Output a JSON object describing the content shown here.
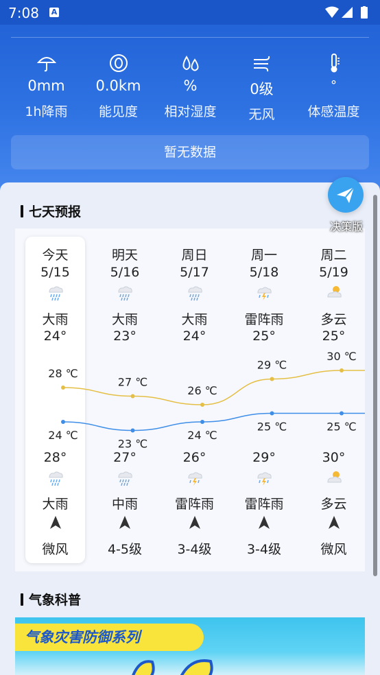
{
  "status_bar": {
    "time": "7:08",
    "app_icon": "a-icon",
    "icons": [
      "wifi-icon",
      "signal-icon",
      "battery-icon"
    ]
  },
  "conditions": [
    {
      "icon": "umbrella-icon",
      "value": "0mm",
      "label": "1h降雨"
    },
    {
      "icon": "eye-icon",
      "value": "0.0km",
      "label": "能见度"
    },
    {
      "icon": "droplets-icon",
      "value": "%",
      "label": "相对湿度"
    },
    {
      "icon": "wind-icon",
      "value": "0级",
      "label": "无风"
    },
    {
      "icon": "thermometer-icon",
      "value": "°",
      "label": "体感温度"
    }
  ],
  "alert_text": "暂无数据",
  "forecast_section": {
    "title": "七天预报"
  },
  "decision_button": {
    "label": "决策版"
  },
  "days": [
    {
      "name": "今天",
      "date": "5/15",
      "day_icon": "heavy-rain-icon",
      "day_weather": "大雨",
      "day_temp": "24°",
      "high_label": "28 ℃",
      "low_label": "24 ℃",
      "night_temp": "28°",
      "night_icon": "heavy-rain-icon",
      "night_weather": "大雨",
      "wind_icon": "wind-direction-arrow-icon",
      "wind": "微风"
    },
    {
      "name": "明天",
      "date": "5/16",
      "day_icon": "heavy-rain-icon",
      "day_weather": "大雨",
      "day_temp": "23°",
      "high_label": "27 ℃",
      "low_label": "23 ℃",
      "night_temp": "27°",
      "night_icon": "moderate-rain-icon",
      "night_weather": "中雨",
      "wind_icon": "wind-direction-arrow-icon",
      "wind": "4-5级"
    },
    {
      "name": "周日",
      "date": "5/17",
      "day_icon": "heavy-rain-icon",
      "day_weather": "大雨",
      "day_temp": "24°",
      "high_label": "26 ℃",
      "low_label": "24 ℃",
      "night_temp": "26°",
      "night_icon": "thunderstorm-icon",
      "night_weather": "雷阵雨",
      "wind_icon": "wind-direction-arrow-icon",
      "wind": "3-4级"
    },
    {
      "name": "周一",
      "date": "5/18",
      "day_icon": "thunderstorm-icon",
      "day_weather": "雷阵雨",
      "day_temp": "25°",
      "high_label": "29 ℃",
      "low_label": "25 ℃",
      "night_temp": "29°",
      "night_icon": "thunderstorm-icon",
      "night_weather": "雷阵雨",
      "wind_icon": "wind-direction-arrow-icon",
      "wind": "3-4级"
    },
    {
      "name": "周二",
      "date": "5/19",
      "day_icon": "partly-cloudy-icon",
      "day_weather": "多云",
      "day_temp": "25°",
      "high_label": "30 ℃",
      "low_label": "25 ℃",
      "night_temp": "30°",
      "night_icon": "partly-cloudy-icon",
      "night_weather": "多云",
      "wind_icon": "wind-direction-arrow-icon",
      "wind": "微风"
    }
  ],
  "temperature_series": {
    "highs": [
      28,
      27,
      26,
      29,
      30,
      30
    ],
    "lows": [
      24,
      23,
      24,
      25,
      25,
      25
    ],
    "high_color": "#e5bf45",
    "low_color": "#3e8ee8"
  },
  "science_section": {
    "title": "气象科普"
  },
  "banner": {
    "text": "气象灾害防御系列"
  },
  "colors": {
    "header_blue": "#2a6ade",
    "accent_yellow": "#f8e43a"
  }
}
